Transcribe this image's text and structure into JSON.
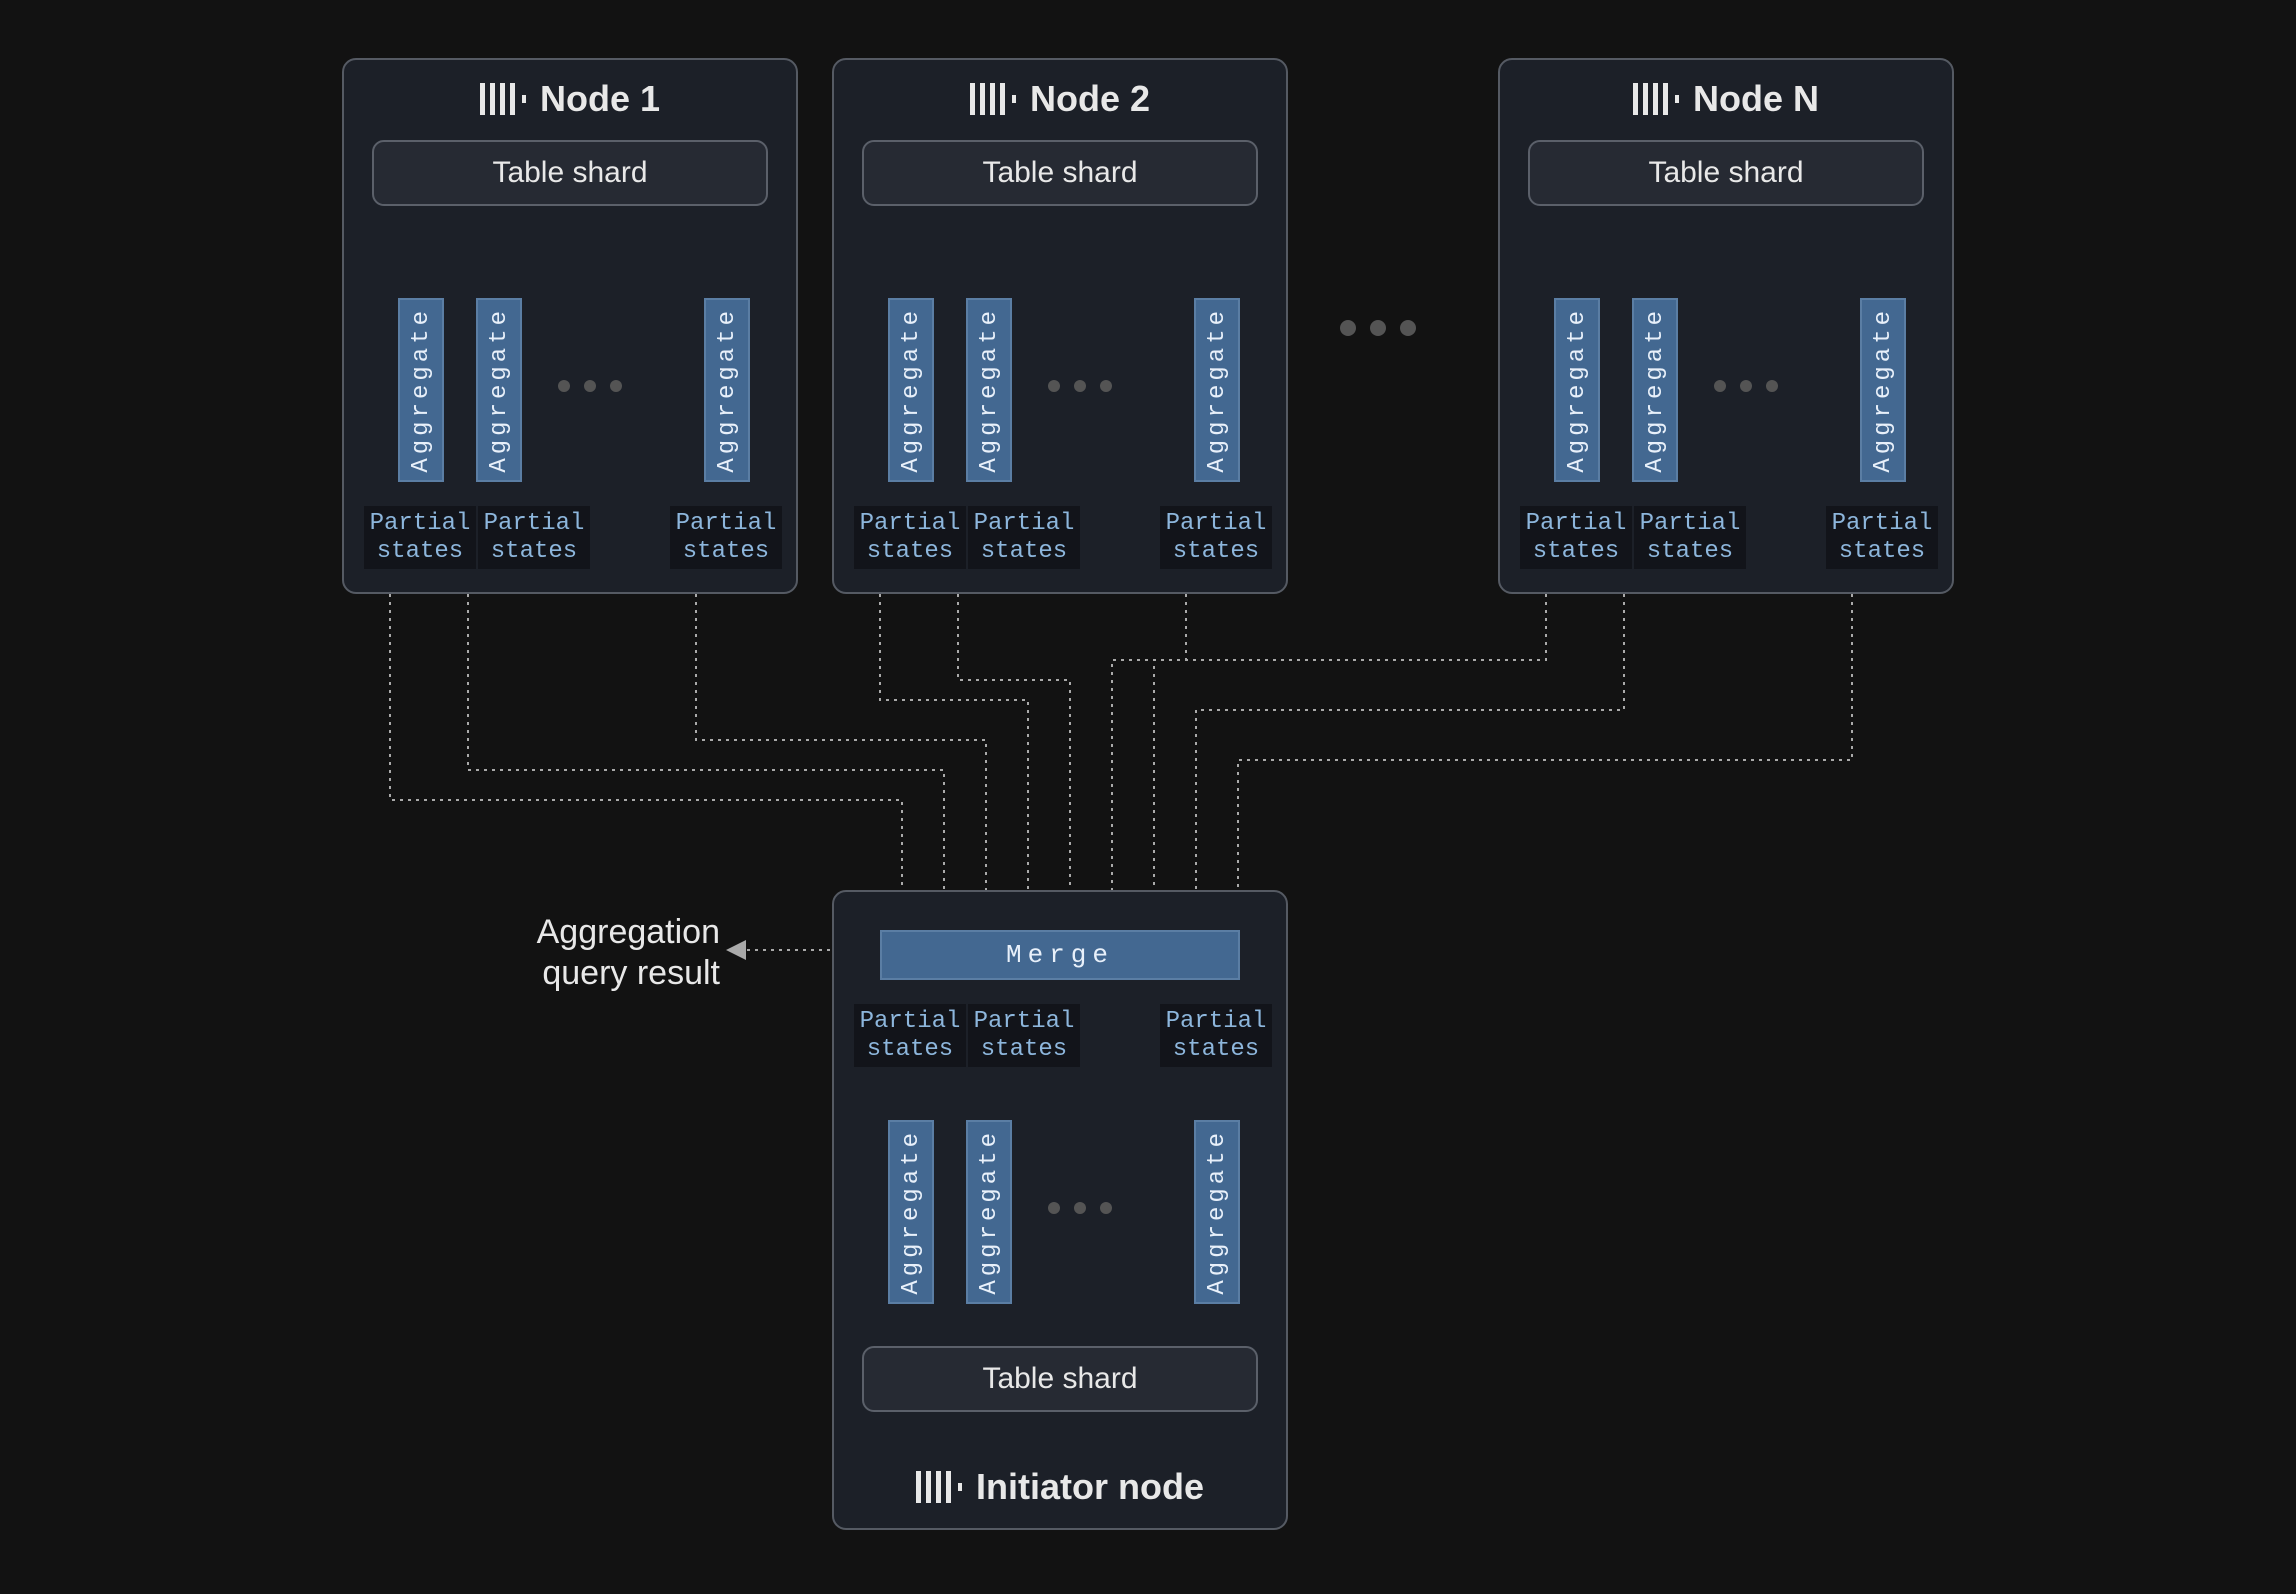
{
  "labels": {
    "table_shard": "Table shard",
    "aggregate": "Aggregate",
    "partial_line1": "Partial",
    "partial_line2": "states",
    "merge": "Merge",
    "initiator": "Initiator node",
    "result_line1": "Aggregation",
    "result_line2": "query result",
    "ellipsis_unicode": "• • •"
  },
  "nodes": [
    {
      "title": "Node 1"
    },
    {
      "title": "Node 2"
    },
    {
      "title": "Node N"
    }
  ],
  "colors": {
    "blue_box": "#436891",
    "blue_text": "#8db6dc",
    "panel": "#1c2028",
    "panel_border": "#555a63"
  },
  "icon_description": "four vertical bars followed by a small dot — stylised database/log icon"
}
